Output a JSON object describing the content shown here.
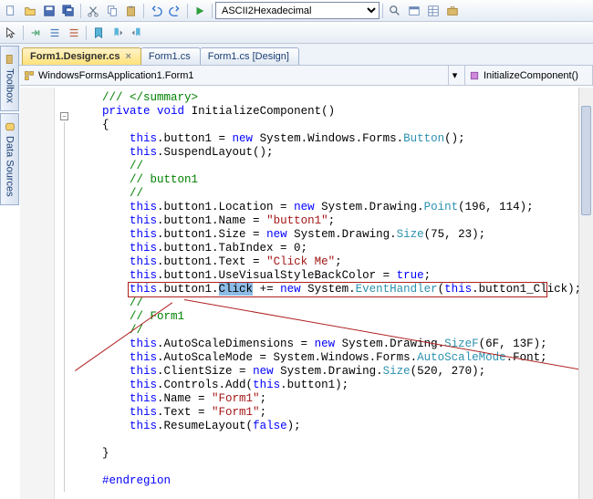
{
  "toolbar": {
    "combo_encoding": "ASCII2Hexadecimal"
  },
  "side_tabs": {
    "toolbox": "Toolbox",
    "data_sources": "Data Sources"
  },
  "doc_tabs": [
    {
      "label": "Form1.Designer.cs",
      "active": true
    },
    {
      "label": "Form1.cs",
      "active": false
    },
    {
      "label": "Form1.cs [Design]",
      "active": false
    }
  ],
  "nav": {
    "left": "WindowsFormsApplication1.Form1",
    "right": "InitializeComponent()"
  },
  "code": {
    "l01": "/// </summary>",
    "l02a": "private",
    "l02b": "void",
    "l02c": " InitializeComponent()",
    "l03": "{",
    "l04a": "this",
    "l04b": ".button1 = ",
    "l04c": "new",
    "l04d": " System.Windows.Forms.",
    "l04e": "Button",
    "l04f": "();",
    "l05a": "this",
    "l05b": ".SuspendLayout();",
    "l06": "// ",
    "l07": "// button1",
    "l08": "// ",
    "l09a": "this",
    "l09b": ".button1.Location = ",
    "l09c": "new",
    "l09d": " System.Drawing.",
    "l09e": "Point",
    "l09f": "(196, 114);",
    "l10a": "this",
    "l10b": ".button1.Name = ",
    "l10c": "\"button1\"",
    "l10d": ";",
    "l11a": "this",
    "l11b": ".button1.Size = ",
    "l11c": "new",
    "l11d": " System.Drawing.",
    "l11e": "Size",
    "l11f": "(75, 23);",
    "l12a": "this",
    "l12b": ".button1.TabIndex = 0;",
    "l13a": "this",
    "l13b": ".button1.Text = ",
    "l13c": "\"Click Me\"",
    "l13d": ";",
    "l14a": "this",
    "l14b": ".button1.UseVisualStyleBackColor = ",
    "l14c": "true",
    "l14d": ";",
    "l15a": "this",
    "l15b": ".button1.",
    "l15c": "Click",
    "l15d": " += ",
    "l15e": "new",
    "l15f": " System.",
    "l15g": "EventHandler",
    "l15h": "(",
    "l15i": "this",
    "l15j": ".button1_Click);",
    "l16": "// ",
    "l17": "// Form1",
    "l18": "// ",
    "l19a": "this",
    "l19b": ".AutoScaleDimensions = ",
    "l19c": "new",
    "l19d": " System.Drawing.",
    "l19e": "SizeF",
    "l19f": "(6F, 13F);",
    "l20a": "this",
    "l20b": ".AutoScaleMode = System.Windows.Forms.",
    "l20c": "AutoScaleMode",
    "l20d": ".Font;",
    "l21a": "this",
    "l21b": ".ClientSize = ",
    "l21c": "new",
    "l21d": " System.Drawing.",
    "l21e": "Size",
    "l21f": "(520, 270);",
    "l22a": "this",
    "l22b": ".Controls.Add(",
    "l22c": "this",
    "l22d": ".button1);",
    "l23a": "this",
    "l23b": ".Name = ",
    "l23c": "\"Form1\"",
    "l23d": ";",
    "l24a": "this",
    "l24b": ".Text = ",
    "l24c": "\"Form1\"",
    "l24d": ";",
    "l25a": "this",
    "l25b": ".ResumeLayout(",
    "l25c": "false",
    "l25d": ");",
    "l26": "",
    "l27": "}",
    "l28": "",
    "l29": "#endregion"
  }
}
